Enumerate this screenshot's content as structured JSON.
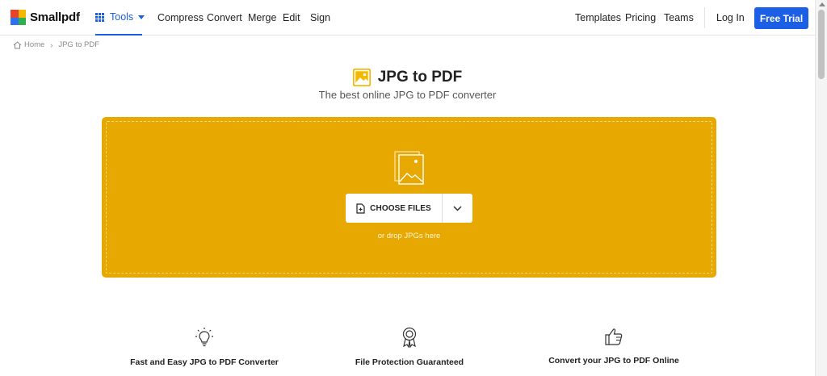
{
  "header": {
    "brand": "Smallpdf",
    "tools_label": "Tools",
    "nav": [
      "Compress",
      "Convert",
      "Merge",
      "Edit",
      "Sign"
    ],
    "right_links": [
      "Templates",
      "Pricing",
      "Teams"
    ],
    "login_label": "Log In",
    "free_trial_label": "Free Trial"
  },
  "breadcrumb": {
    "home": "Home",
    "current": "JPG to PDF"
  },
  "hero": {
    "title": "JPG to PDF",
    "subtitle": "The best online JPG to PDF converter"
  },
  "dropzone": {
    "choose_files_label": "CHOOSE FILES",
    "drop_hint": "or drop JPGs here"
  },
  "features": [
    {
      "icon": "lightbulb-icon",
      "title": "Fast and Easy JPG to PDF Converter"
    },
    {
      "icon": "award-ribbon-icon",
      "title": "File Protection Guaranteed"
    },
    {
      "icon": "thumbs-up-icon",
      "title": "Convert your JPG to PDF Online"
    }
  ],
  "colors": {
    "accent_blue": "#1a5fe6",
    "dropzone_yellow": "#e8a802",
    "title_icon_yellow": "#f4b800"
  }
}
